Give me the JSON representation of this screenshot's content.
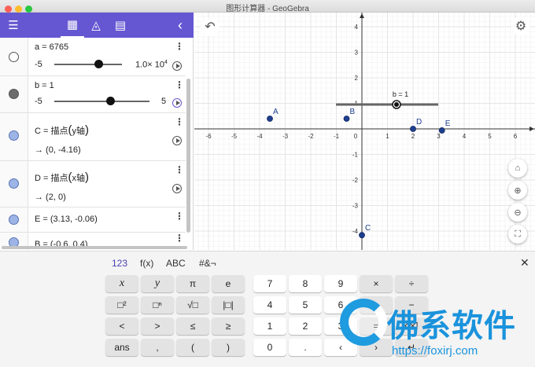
{
  "window": {
    "title": "图形计算器 - GeoGebra"
  },
  "toolbar": {
    "menu_icon": "☰",
    "calc_icon": "▦",
    "geometry_icon": "◬",
    "table_icon": "▤",
    "collapse_icon": "‹"
  },
  "algebra": {
    "rows": [
      {
        "text": "a = 6765",
        "slider_min": "-5",
        "slider_max": "1.0× 10",
        "slider_max_exp": "4",
        "slider_fraction": 0.64
      },
      {
        "text": "b = 1",
        "slider_min": "-5",
        "slider_max": "5",
        "slider_fraction": 0.6
      },
      {
        "text": "C = 描点",
        "arg": "y轴",
        "result": "→  (0, -4.16)"
      },
      {
        "text": "D = 描点",
        "arg": "x轴",
        "result": "→  (2, 0)"
      },
      {
        "text": "E = (3.13, -0.06)"
      },
      {
        "text": "B = (-0.6, 0.4)"
      }
    ]
  },
  "graph": {
    "x_ticks": [
      "-6",
      "-5",
      "-4",
      "-3",
      "-2",
      "-1",
      "0",
      "1",
      "2",
      "3",
      "4",
      "5",
      "6"
    ],
    "y_ticks": [
      "4",
      "3",
      "2",
      "1",
      "-1",
      "-2",
      "-3",
      "-4"
    ],
    "slider_label": "b = 1",
    "points": [
      {
        "name": "A",
        "x": -3.6,
        "y": 0.4
      },
      {
        "name": "B",
        "x": -0.6,
        "y": 0.4
      },
      {
        "name": "C",
        "x": 0,
        "y": -4.16
      },
      {
        "name": "D",
        "x": 2,
        "y": 0
      },
      {
        "name": "E",
        "x": 3.13,
        "y": -0.06
      }
    ],
    "colors": {
      "point": "#1e3f8e",
      "grid": "#e5e5e5",
      "axis": "#333333"
    }
  },
  "keyboard": {
    "tabs": [
      "123",
      "f(x)",
      "ABC",
      "#&¬"
    ],
    "close": "✕",
    "rows": [
      [
        "x",
        "y",
        "π",
        "e",
        "7",
        "8",
        "9",
        "×",
        "÷"
      ],
      [
        "□²",
        "□ⁿ",
        "√□",
        "|□|",
        "4",
        "5",
        "6",
        "+",
        "−"
      ],
      [
        "<",
        ">",
        "≤",
        "≥",
        "1",
        "2",
        "3",
        "=",
        "⌫"
      ],
      [
        "ans",
        ",",
        "(",
        ")",
        "0",
        ".",
        "‹",
        "›",
        "↵"
      ]
    ]
  },
  "watermark": {
    "text": "佛系软件",
    "url": "https://foxirj.com"
  }
}
